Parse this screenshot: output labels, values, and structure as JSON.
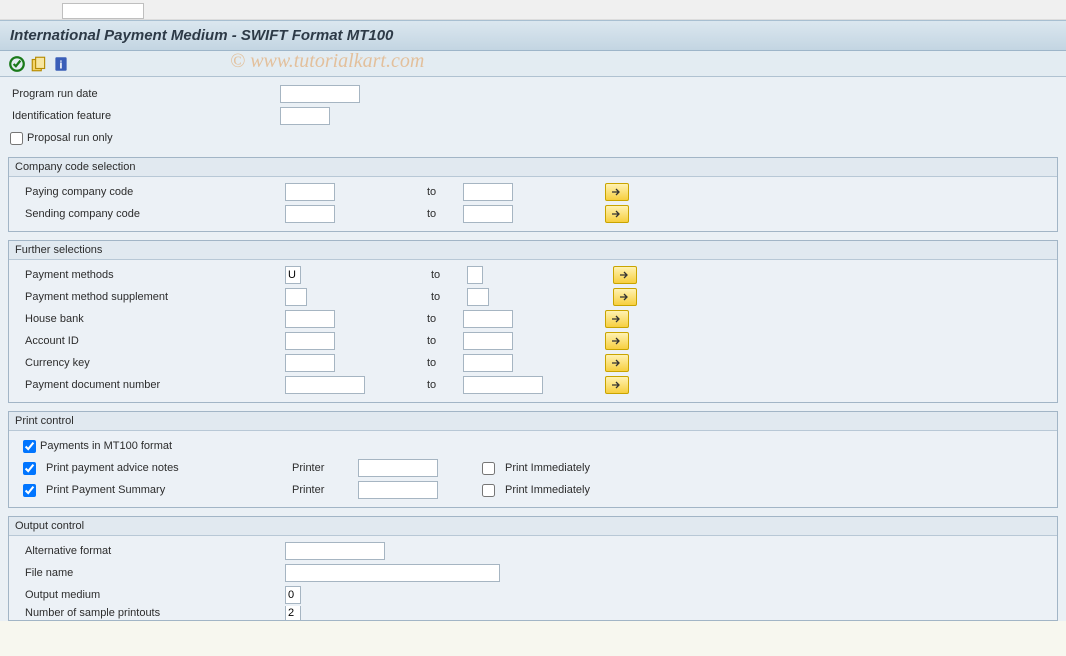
{
  "header": {
    "title": "International Payment Medium - SWIFT Format MT100"
  },
  "watermark": "© www.tutorialkart.com",
  "topfields": {
    "run_date_label": "Program run date",
    "run_date_value": "",
    "ident_label": "Identification feature",
    "ident_value": "",
    "proposal_label": "Proposal run only",
    "proposal_checked": false
  },
  "to_text": "to",
  "groups": {
    "company": {
      "title": "Company code selection",
      "rows": [
        {
          "label": "Paying company code",
          "from": "",
          "to": ""
        },
        {
          "label": "Sending company code",
          "from": "",
          "to": ""
        }
      ]
    },
    "further": {
      "title": "Further selections",
      "rows": [
        {
          "label": "Payment methods",
          "from": "U",
          "to": "",
          "narrow": true
        },
        {
          "label": "Payment method supplement",
          "from": "",
          "to": "",
          "narrow": true
        },
        {
          "label": "House bank",
          "from": "",
          "to": ""
        },
        {
          "label": "Account ID",
          "from": "",
          "to": ""
        },
        {
          "label": "Currency key",
          "from": "",
          "to": ""
        },
        {
          "label": "Payment document number",
          "from": "",
          "to": "",
          "wide": true
        }
      ]
    },
    "print": {
      "title": "Print control",
      "mt100_label": "Payments in MT100 format",
      "mt100_checked": true,
      "advice_label": "Print payment advice notes",
      "advice_checked": true,
      "summary_label": "Print Payment Summary",
      "summary_checked": true,
      "printer_label": "Printer",
      "advice_printer": "",
      "summary_printer": "",
      "immediately_label": "Print Immediately",
      "advice_immediate": false,
      "summary_immediate": false
    },
    "output": {
      "title": "Output control",
      "alt_label": "Alternative format",
      "alt_value": "",
      "file_label": "File name",
      "file_value": "",
      "medium_label": "Output medium",
      "medium_value": "0",
      "sample_label": "Number of sample printouts",
      "sample_value": "2"
    }
  }
}
